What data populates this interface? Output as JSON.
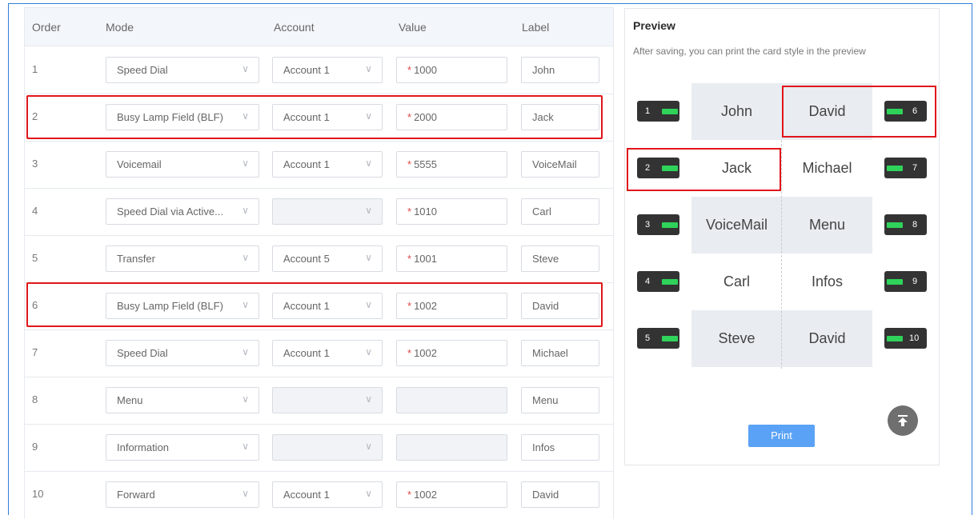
{
  "table": {
    "headers": {
      "order": "Order",
      "mode": "Mode",
      "account": "Account",
      "value": "Value",
      "label": "Label"
    },
    "rows": [
      {
        "order": "1",
        "mode": "Speed Dial",
        "account": "Account 1",
        "value": "1000",
        "label": "John"
      },
      {
        "order": "2",
        "mode": "Busy Lamp Field (BLF)",
        "account": "Account 1",
        "value": "2000",
        "label": "Jack"
      },
      {
        "order": "3",
        "mode": "Voicemail",
        "account": "Account 1",
        "value": "5555",
        "label": "VoiceMail"
      },
      {
        "order": "4",
        "mode": "Speed Dial via Active...",
        "account": "",
        "value": "1010",
        "label": "Carl"
      },
      {
        "order": "5",
        "mode": "Transfer",
        "account": "Account 5",
        "value": "1001",
        "label": "Steve"
      },
      {
        "order": "6",
        "mode": "Busy Lamp Field (BLF)",
        "account": "Account 1",
        "value": "1002",
        "label": "David"
      },
      {
        "order": "7",
        "mode": "Speed Dial",
        "account": "Account 1",
        "value": "1002",
        "label": "Michael"
      },
      {
        "order": "8",
        "mode": "Menu",
        "account": "",
        "value": "",
        "label": "Menu"
      },
      {
        "order": "9",
        "mode": "Information",
        "account": "",
        "value": "",
        "label": "Infos"
      },
      {
        "order": "10",
        "mode": "Forward",
        "account": "Account 1",
        "value": "1002",
        "label": "David"
      }
    ],
    "required_mark": "*"
  },
  "preview": {
    "title": "Preview",
    "subtitle": "After saving, you can print the card style in the preview",
    "left_labels": [
      "John",
      "Jack",
      "VoiceMail",
      "Carl",
      "Steve"
    ],
    "right_labels": [
      "David",
      "Michael",
      "Menu",
      "Infos",
      "David"
    ],
    "left_keys": [
      "1",
      "2",
      "3",
      "4",
      "5"
    ],
    "right_keys": [
      "6",
      "7",
      "8",
      "9",
      "10"
    ],
    "print_label": "Print"
  },
  "icons": {
    "back_to_top": "arrow-up-bar-icon",
    "chevron": "chevron-down-icon"
  },
  "colors": {
    "highlight": "#e0161b",
    "led": "#2fd35a",
    "print_button": "#5aa2f5"
  }
}
